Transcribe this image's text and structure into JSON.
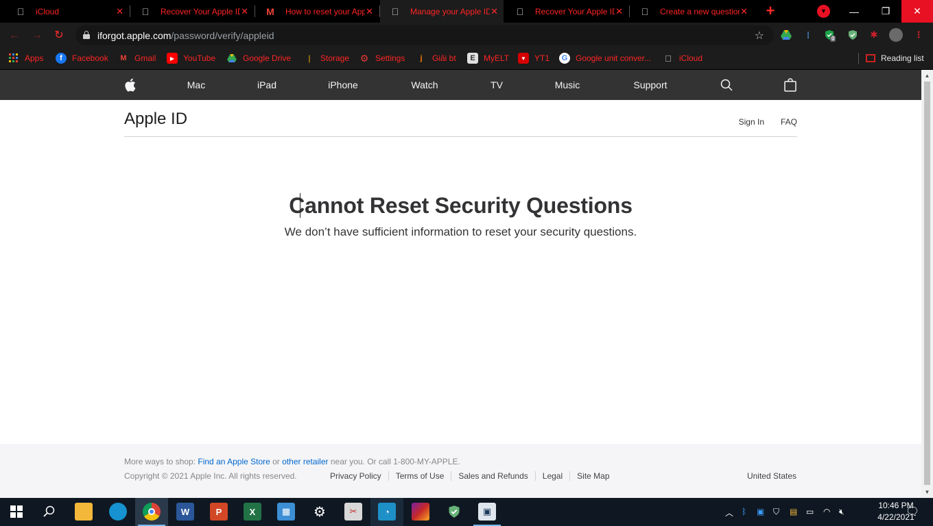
{
  "browser": {
    "tabs": [
      {
        "title": "iCloud",
        "active": false
      },
      {
        "title": "Recover Your Apple ID",
        "active": false
      },
      {
        "title": "How to reset your Apple",
        "active": false
      },
      {
        "title": "Manage your Apple ID",
        "active": true
      },
      {
        "title": "Recover Your Apple ID",
        "active": false
      },
      {
        "title": "Create a new question",
        "active": false
      }
    ],
    "url_host": "iforgot.apple.com",
    "url_path": "/password/verify/appleid",
    "extension_badge": "0",
    "bookmarks": [
      {
        "label": "Apps",
        "icon": "apps-grid-icon"
      },
      {
        "label": "Facebook",
        "icon": "facebook-icon"
      },
      {
        "label": "Gmail",
        "icon": "gmail-icon"
      },
      {
        "label": "YouTube",
        "icon": "youtube-icon"
      },
      {
        "label": "Google Drive",
        "icon": "google-drive-icon"
      },
      {
        "label": "Storage",
        "icon": "storage-icon"
      },
      {
        "label": "Settings",
        "icon": "settings-gear-icon"
      },
      {
        "label": "Giải bt",
        "icon": "giai-bt-icon"
      },
      {
        "label": "MyELT",
        "icon": "myelt-icon"
      },
      {
        "label": "YT1",
        "icon": "yt1-icon"
      },
      {
        "label": "Google unit conver...",
        "icon": "google-icon"
      },
      {
        "label": "iCloud",
        "icon": "apple-icon"
      }
    ],
    "reading_list": "Reading list"
  },
  "globalnav": {
    "items": [
      "Mac",
      "iPad",
      "iPhone",
      "Watch",
      "TV",
      "Music",
      "Support"
    ]
  },
  "localnav": {
    "title": "Apple ID",
    "sign_in": "Sign In",
    "faq": "FAQ"
  },
  "main": {
    "title": "Cannot Reset Security Questions",
    "subtitle": "We don’t have sufficient information to reset your security questions."
  },
  "footer": {
    "shop_prefix": "More ways to shop: ",
    "find_store": "Find an Apple Store",
    "or": " or ",
    "other_retailer": "other retailer",
    "shop_suffix": " near you. Or call 1-800-MY-APPLE.",
    "copyright": "Copyright © 2021 Apple Inc. All rights reserved.",
    "links": [
      "Privacy Policy",
      "Terms of Use",
      "Sales and Refunds",
      "Legal",
      "Site Map"
    ],
    "country": "United States"
  },
  "taskbar": {
    "time": "10:46 PM",
    "date": "4/22/2021",
    "apps": [
      "start-icon",
      "search-icon",
      "file-explorer-icon",
      "edge-icon",
      "chrome-icon",
      "word-icon",
      "powerpoint-icon",
      "excel-icon",
      "control-panel-icon",
      "settings-icon",
      "snip-icon",
      "speedtest-icon",
      "winrar-icon",
      "shield-app-icon",
      "remote-desktop-icon"
    ]
  },
  "colors": {
    "tab_text": "#ff2424",
    "nav_bg": "#333333",
    "link_blue": "#0066cc",
    "taskbar_bg": "#0f1822"
  }
}
